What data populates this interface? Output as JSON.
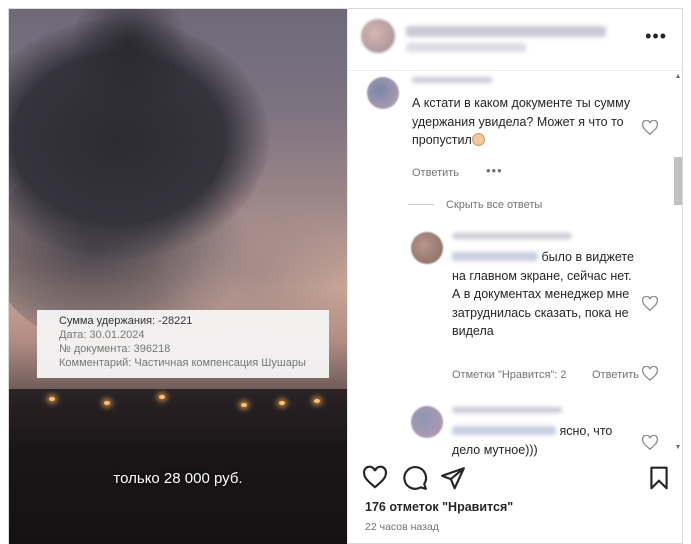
{
  "media": {
    "overlay": {
      "line1": "Сумма удержания: -28221",
      "line2": "Дата: 30.01.2024",
      "line3": "№ документа: 396218",
      "line4": "Комментарий: Частичная компенсация Шушары"
    },
    "caption": "только 28 000 руб."
  },
  "header": {
    "more_icon": "more-horizontal-icon",
    "more_glyph": "•••"
  },
  "comments": [
    {
      "text": "А кстати в каком документе ты сумму удержания увидела? Может я что то пропустил",
      "reply_label": "Ответить",
      "more_glyph": "•••"
    }
  ],
  "hide_replies_label": "Скрыть все ответы",
  "replies": [
    {
      "text_tail": "было в виджете на главном экране, сейчас нет. А в документах менеджер мне затруднилась сказать, пока не видела",
      "likes_label": "Отметки \"Нравится\": 2",
      "reply_label": "Ответить"
    },
    {
      "text_tail": "ясно, что дело мутное)))"
    }
  ],
  "post": {
    "likes_text": "176 отметок \"Нравится\"",
    "time_text": "22 часов назад"
  },
  "colors": {
    "text": "#262626",
    "muted": "#737373",
    "border": "#dbdbdb"
  }
}
